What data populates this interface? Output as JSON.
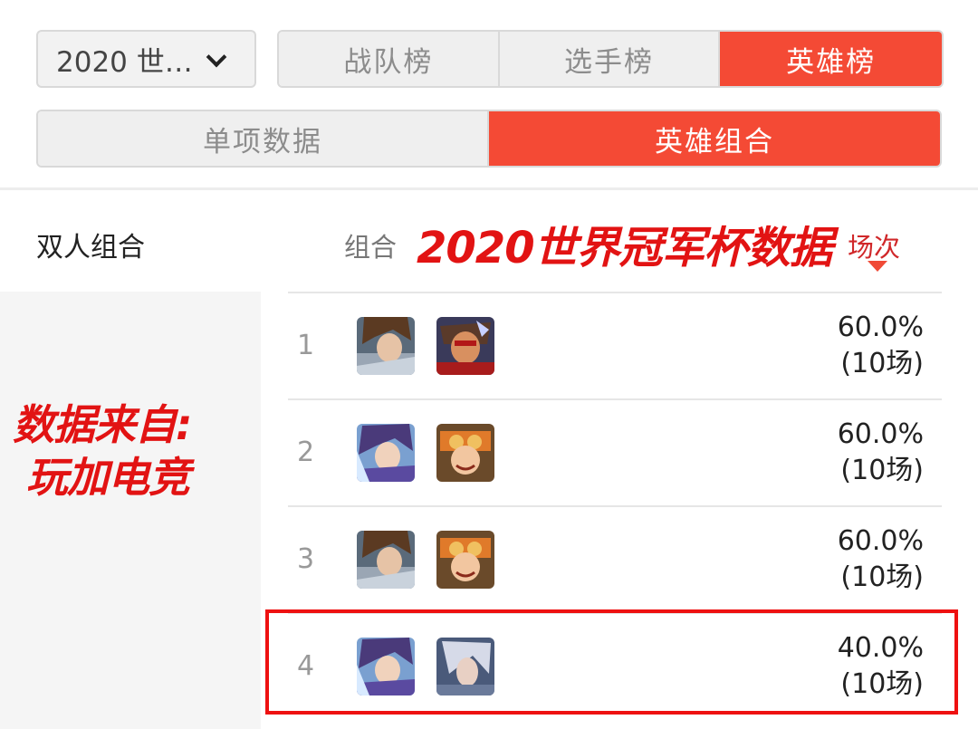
{
  "filters": {
    "season": "2020 世…",
    "tabs": [
      {
        "label": "战队榜",
        "active": false
      },
      {
        "label": "选手榜",
        "active": false
      },
      {
        "label": "英雄榜",
        "active": true
      }
    ],
    "subtabs": [
      {
        "label": "单项数据",
        "active": false
      },
      {
        "label": "英雄组合",
        "active": true
      }
    ]
  },
  "header": {
    "combo_type": "双人组合",
    "col_combo": "组合",
    "col_games": "场次",
    "overlay_title": "2020世界冠军杯数据"
  },
  "source_note": "数据来自:\n 玩加电竞",
  "rows": [
    {
      "rank": "1",
      "rate": "60.0%",
      "games": "(10场)",
      "heroes": [
        "hero-brown-hair-icon",
        "hero-red-mask-icon"
      ]
    },
    {
      "rank": "2",
      "rate": "60.0%",
      "games": "(10场)",
      "heroes": [
        "hero-purple-hair-icon",
        "hero-goggles-girl-icon"
      ]
    },
    {
      "rank": "3",
      "rate": "60.0%",
      "games": "(10场)",
      "heroes": [
        "hero-brown-hair-icon",
        "hero-goggles-girl-icon"
      ]
    },
    {
      "rank": "4",
      "rate": "40.0%",
      "games": "(10场)",
      "heroes": [
        "hero-purple-hair-icon",
        "hero-silver-hair-icon"
      ]
    }
  ],
  "colors": {
    "accent": "#f44a35",
    "annotation": "#e21313"
  }
}
